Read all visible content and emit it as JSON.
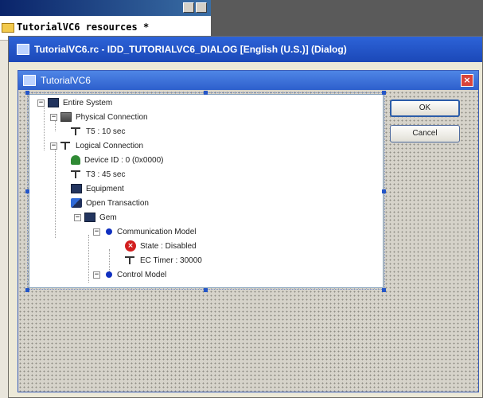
{
  "workspace": {
    "item_label": "TutorialVC6 resources *"
  },
  "editor": {
    "title": "TutorialVC6.rc - IDD_TUTORIALVC6_DIALOG [English (U.S.)] (Dialog)"
  },
  "dialog": {
    "title": "TutorialVC6",
    "close_glyph": "×",
    "buttons": {
      "ok": "OK",
      "cancel": "Cancel"
    }
  },
  "tree": {
    "items": [
      {
        "label": "Entire System",
        "icon": "computer-icon",
        "expander": "−"
      },
      {
        "label": "Physical Connection",
        "icon": "network-icon",
        "expander": "−"
      },
      {
        "label": "T5 : 10 sec",
        "icon": "connector-icon"
      },
      {
        "label": "Logical Connection",
        "icon": "connector-icon",
        "expander": "−"
      },
      {
        "label": "Device ID : 0 (0x0000)",
        "icon": "bell-icon"
      },
      {
        "label": "T3 : 45 sec",
        "icon": "connector-icon"
      },
      {
        "label": "Equipment",
        "icon": "computer-icon"
      },
      {
        "label": "Open Transaction",
        "icon": "transaction-icon"
      },
      {
        "label": "Gem",
        "icon": "computer-icon",
        "expander": "−"
      },
      {
        "label": "Communication Model",
        "icon": "dot-icon",
        "expander": "−"
      },
      {
        "label": "State : Disabled",
        "icon": "error-icon"
      },
      {
        "label": "EC Timer : 30000",
        "icon": "connector-icon"
      },
      {
        "label": "Control Model",
        "icon": "dot-icon",
        "expander": "−"
      }
    ]
  },
  "colors": {
    "title_blue": "#2d63d8",
    "handle_blue": "#2456c8",
    "error_red": "#d21f1f"
  }
}
